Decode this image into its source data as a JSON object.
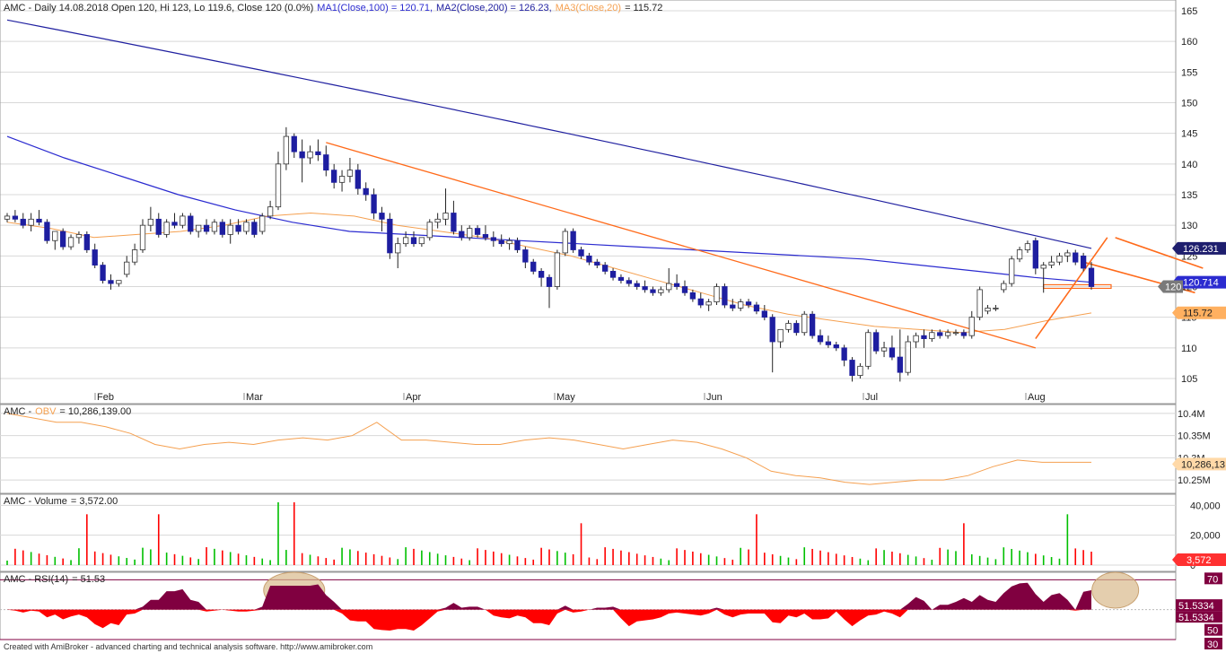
{
  "header": {
    "main": "AMC - Daily 14.08.2018 Open 120, Hi 123, Lo 119.6, Close 120 (0.0%)",
    "ma1": "MA1(Close,100) = 120.71,",
    "ma2": "MA2(Close,200) = 126.23,",
    "ma3": "MA3(Close,20)",
    "ma3_value": "= 115.72"
  },
  "price_labels": {
    "ma2": "126.231",
    "ma1": "120.714",
    "close": "120",
    "ma3": "115.72"
  },
  "months": [
    "Feb",
    "Mar",
    "Apr",
    "May",
    "Jun",
    "Jul",
    "Aug"
  ],
  "footer": "Created with AmiBroker - advanced charting and technical analysis software. http://www.amibroker.com",
  "obv": {
    "label_prefix": "AMC -",
    "label_name": "OBV",
    "label_value": "= 10,286,139.00",
    "ticks": [
      "10.4M",
      "10.35M",
      "10.3M",
      "10.25M"
    ],
    "current_label": "10,286,13"
  },
  "volume": {
    "label_prefix": "AMC - Volume",
    "label_value": "= 3,572.00",
    "ticks": [
      "40,000",
      "20,000",
      "0"
    ],
    "current_label": "3,572"
  },
  "rsi": {
    "label_prefix": "AMC - RSI(14)",
    "label_value": "= 51.53",
    "ticks": [
      "70",
      "50",
      "30"
    ],
    "value_labels": [
      "70",
      "51.5334",
      "51.5334",
      "50",
      "30"
    ]
  },
  "colors": {
    "up": "#ffffff",
    "down": "#1e1ea0",
    "ma1": "#2b2bd0",
    "ma2": "#2020a0",
    "ma3": "#f5a050",
    "trend": "#ff6a1a",
    "vol_up": "#00c000",
    "vol_down": "#ff0000",
    "rsi_pos": "#800040",
    "rsi_neg": "#ff0000",
    "channel": "#39c93c"
  },
  "chart_data": [
    {
      "type": "candlestick",
      "title": "AMC - Daily 14.08.2018",
      "x": "trading days, mid Jan 2018 to 14 Aug 2018",
      "ylim": [
        103,
        167
      ],
      "y_ticks": [
        105,
        110,
        115,
        120,
        125,
        130,
        135,
        140,
        145,
        150,
        155,
        160,
        165
      ],
      "candles": [
        [
          131,
          132,
          130.5,
          131.5
        ],
        [
          131.5,
          132.5,
          130.5,
          131
        ],
        [
          131,
          132,
          129.5,
          130
        ],
        [
          130,
          132,
          129,
          131
        ],
        [
          131,
          132.5,
          130,
          130.5
        ],
        [
          130.5,
          131,
          127,
          127.5
        ],
        [
          127.5,
          128.5,
          126,
          129
        ],
        [
          129,
          129.5,
          126,
          126.5
        ],
        [
          126.5,
          128.5,
          126,
          128
        ],
        [
          128,
          129,
          127,
          128.5
        ],
        [
          128.5,
          129,
          125.5,
          126
        ],
        [
          126,
          127,
          123,
          123.5
        ],
        [
          123.5,
          124,
          120.5,
          121
        ],
        [
          121,
          122,
          119.5,
          120.5
        ],
        [
          120.5,
          121,
          120,
          121
        ],
        [
          122,
          125,
          121.5,
          124
        ],
        [
          124,
          127,
          123.5,
          126
        ],
        [
          126,
          131,
          125.5,
          130
        ],
        [
          130,
          133,
          129,
          131
        ],
        [
          131,
          132,
          128,
          128.5
        ],
        [
          128.5,
          131,
          128,
          130.5
        ],
        [
          130.5,
          132,
          129.5,
          130
        ],
        [
          130,
          132,
          129.5,
          131.5
        ],
        [
          131.5,
          132,
          128.5,
          129
        ],
        [
          129,
          130,
          128,
          130
        ],
        [
          130,
          131,
          128.5,
          129
        ],
        [
          129,
          131,
          128.5,
          130.5
        ],
        [
          130.5,
          131,
          128,
          128.5
        ],
        [
          128.5,
          131,
          127,
          130
        ],
        [
          130,
          131,
          128.5,
          129
        ],
        [
          129,
          131,
          128.5,
          130.5
        ],
        [
          130.5,
          131,
          128,
          128.5
        ],
        [
          129,
          132,
          128.5,
          131.5
        ],
        [
          131.5,
          134,
          131,
          133
        ],
        [
          133,
          142,
          132.5,
          140
        ],
        [
          140,
          146,
          139,
          144.5
        ],
        [
          144.5,
          145,
          141,
          142
        ],
        [
          142,
          144,
          137,
          141
        ],
        [
          141,
          143,
          140,
          142
        ],
        [
          142,
          144,
          140.5,
          141.5
        ],
        [
          141.5,
          143,
          138,
          139
        ],
        [
          139,
          140,
          136,
          137
        ],
        [
          137,
          139,
          135.5,
          138
        ],
        [
          138,
          141,
          137,
          139
        ],
        [
          139,
          140,
          135,
          136
        ],
        [
          136,
          137,
          134,
          135
        ],
        [
          135,
          136,
          131,
          132
        ],
        [
          132,
          133,
          129,
          131
        ],
        [
          131,
          132,
          124.5,
          125.5
        ],
        [
          125.5,
          128,
          123,
          127
        ],
        [
          127,
          129,
          126.5,
          128
        ],
        [
          128,
          129,
          126.5,
          127
        ],
        [
          127,
          128,
          126.5,
          128
        ],
        [
          128,
          131,
          127.5,
          130.5
        ],
        [
          130.5,
          132,
          129.5,
          131
        ],
        [
          131,
          136,
          130,
          132
        ],
        [
          132,
          134,
          128.5,
          129
        ],
        [
          129,
          130,
          127.5,
          128
        ],
        [
          128,
          130,
          127.5,
          129.5
        ],
        [
          129.5,
          130,
          128,
          128.5
        ],
        [
          128.5,
          130,
          127.5,
          128
        ],
        [
          128,
          129,
          126.5,
          127.5
        ],
        [
          127.5,
          128.5,
          126.5,
          127
        ],
        [
          127,
          128,
          126,
          127.5
        ],
        [
          127.5,
          128,
          125.5,
          126
        ],
        [
          126,
          126.5,
          123,
          124
        ],
        [
          124,
          124.5,
          122,
          122.5
        ],
        [
          122.5,
          123,
          120,
          121.5
        ],
        [
          121.5,
          122,
          116.5,
          120
        ],
        [
          120,
          126,
          119.5,
          125.5
        ],
        [
          125.5,
          129.5,
          125,
          129
        ],
        [
          129,
          129.5,
          125.5,
          126
        ],
        [
          126,
          126.5,
          124.5,
          125
        ],
        [
          125,
          125.5,
          123.5,
          124
        ],
        [
          124,
          124.5,
          123,
          123.5
        ],
        [
          123.5,
          124,
          122,
          122.5
        ],
        [
          122.5,
          123,
          121,
          121.5
        ],
        [
          121.5,
          122,
          120.5,
          121
        ],
        [
          121,
          121.5,
          120,
          120.5
        ],
        [
          120.5,
          121,
          119.5,
          120
        ],
        [
          120,
          121,
          119,
          119.5
        ],
        [
          119.5,
          120,
          118.5,
          119
        ],
        [
          119,
          120,
          118.5,
          119.5
        ],
        [
          119.5,
          123,
          119,
          120.5
        ],
        [
          120.5,
          122,
          119.5,
          120
        ],
        [
          120,
          121,
          118.5,
          119
        ],
        [
          119,
          119.5,
          117.5,
          118
        ],
        [
          118,
          119,
          116.5,
          117
        ],
        [
          117,
          118,
          116,
          117.5
        ],
        [
          117.5,
          120.5,
          117,
          120
        ],
        [
          120,
          120.5,
          116.5,
          117
        ],
        [
          117,
          118,
          116,
          116.5
        ],
        [
          116.5,
          118,
          116,
          117.5
        ],
        [
          117.5,
          118,
          116.5,
          117
        ],
        [
          117,
          117.5,
          115.5,
          116
        ],
        [
          116,
          117,
          114.5,
          115
        ],
        [
          115,
          115.5,
          106,
          111
        ],
        [
          111,
          113,
          110,
          113
        ],
        [
          113,
          114.5,
          112.5,
          114
        ],
        [
          114,
          114.5,
          112,
          112.5
        ],
        [
          112.5,
          116,
          112,
          115.5
        ],
        [
          115.5,
          116,
          111.5,
          112
        ],
        [
          112,
          113,
          110.5,
          111
        ],
        [
          111,
          112,
          110,
          110.5
        ],
        [
          110.5,
          111,
          109.5,
          110
        ],
        [
          110,
          110.5,
          107,
          108
        ],
        [
          108,
          108.5,
          104.5,
          105.5
        ],
        [
          105.5,
          107.5,
          105,
          107
        ],
        [
          107,
          113,
          106.5,
          112.5
        ],
        [
          112.5,
          113,
          109,
          109.5
        ],
        [
          109.5,
          111,
          108.5,
          110
        ],
        [
          110,
          112,
          108,
          108.5
        ],
        [
          108.5,
          113,
          104.5,
          106
        ],
        [
          106,
          112,
          105.5,
          111
        ],
        [
          111,
          112.5,
          110,
          112
        ],
        [
          112,
          113,
          110,
          111.5
        ],
        [
          111.5,
          113,
          111,
          112.5
        ],
        [
          112.5,
          113,
          111.5,
          112
        ],
        [
          112,
          113,
          111.5,
          112.5
        ],
        [
          112.5,
          113,
          112,
          112.5
        ],
        [
          112.5,
          113,
          111.5,
          112
        ],
        [
          112,
          116,
          111.5,
          115
        ],
        [
          115,
          120,
          114.5,
          119.5
        ],
        [
          116,
          117,
          115.5,
          116.5
        ],
        [
          116.5,
          117,
          116,
          116.5
        ],
        [
          119.5,
          121,
          119,
          120.5
        ],
        [
          120.5,
          125,
          120,
          124.5
        ],
        [
          124.5,
          126.5,
          124,
          126
        ],
        [
          126,
          127.5,
          125.5,
          127
        ],
        [
          127.5,
          128,
          122,
          123
        ],
        [
          123,
          124,
          119,
          123.5
        ],
        [
          123.5,
          125,
          123,
          124
        ],
        [
          124,
          125.5,
          123.5,
          125
        ],
        [
          125,
          126,
          124,
          125.5
        ],
        [
          125.5,
          126,
          123.5,
          124
        ],
        [
          125,
          125.5,
          122.5,
          123
        ],
        [
          123,
          124,
          119.5,
          120
        ]
      ],
      "ma1_endpoints": [
        144.5,
        120.71
      ],
      "ma2_endpoints": [
        163.5,
        126.23
      ],
      "ma3_endpoints": [
        130.5,
        115.72
      ],
      "last": {
        "open": 120,
        "high": 123,
        "low": 119.6,
        "close": 120
      }
    },
    {
      "type": "line",
      "title": "AMC - OBV = 10,286,139.00",
      "ylim": [
        10.22,
        10.42
      ],
      "y_ticks": [
        10.25,
        10.3,
        10.35,
        10.4
      ],
      "last": 10.286139
    },
    {
      "type": "bar",
      "title": "AMC - Volume = 3,572.00",
      "ylim": [
        0,
        48000
      ],
      "y_ticks": [
        0,
        20000,
        40000
      ],
      "last": 3572
    },
    {
      "type": "area",
      "title": "AMC - RSI(14) = 51.53",
      "ylim": [
        30,
        75
      ],
      "y_ticks": [
        30,
        50,
        70
      ],
      "last": 51.53
    }
  ]
}
